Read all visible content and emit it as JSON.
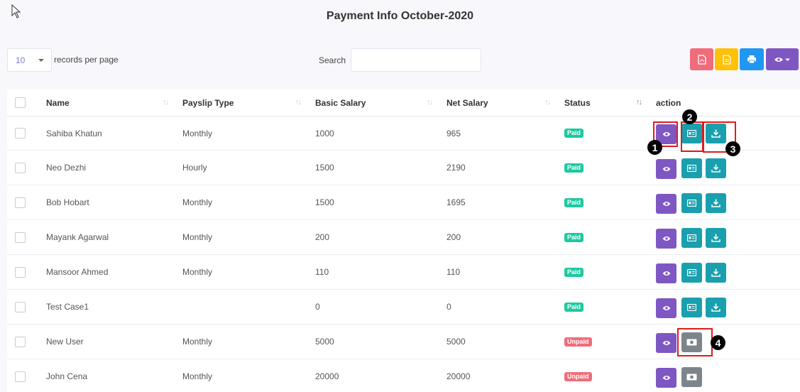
{
  "page": {
    "title": "Payment Info October-2020"
  },
  "controls": {
    "records_per_page_value": "10",
    "records_per_page_label": "records per page",
    "search_label": "Search",
    "search_value": ""
  },
  "columns": [
    "Name",
    "Payslip Type",
    "Basic Salary",
    "Net Salary",
    "Status",
    "action"
  ],
  "rows": [
    {
      "name": "Sahiba Khatun",
      "payslip_type": "Monthly",
      "basic_salary": "1000",
      "net_salary": "965",
      "status": "Paid"
    },
    {
      "name": "Neo Dezhi",
      "payslip_type": "Hourly",
      "basic_salary": "1500",
      "net_salary": "2190",
      "status": "Paid"
    },
    {
      "name": "Bob Hobart",
      "payslip_type": "Monthly",
      "basic_salary": "1500",
      "net_salary": "1695",
      "status": "Paid"
    },
    {
      "name": "Mayank Agarwal",
      "payslip_type": "Monthly",
      "basic_salary": "200",
      "net_salary": "200",
      "status": "Paid"
    },
    {
      "name": "Mansoor Ahmed",
      "payslip_type": "Monthly",
      "basic_salary": "110",
      "net_salary": "110",
      "status": "Paid"
    },
    {
      "name": "Test Case1",
      "payslip_type": "",
      "basic_salary": "0",
      "net_salary": "0",
      "status": "Paid"
    },
    {
      "name": "New User",
      "payslip_type": "Monthly",
      "basic_salary": "5000",
      "net_salary": "5000",
      "status": "Unpaid"
    },
    {
      "name": "John Cena",
      "payslip_type": "Monthly",
      "basic_salary": "20000",
      "net_salary": "20000",
      "status": "Unpaid"
    }
  ],
  "callouts": [
    "1",
    "2",
    "3",
    "4"
  ],
  "icons": {
    "tools": [
      "pdf-icon",
      "file-icon",
      "print-icon",
      "eye-dropdown-icon"
    ],
    "actions": [
      "eye-icon",
      "payslip-icon",
      "download-icon",
      "money-icon"
    ]
  },
  "colors": {
    "view": "#7e57c2",
    "payslip": "#1a9fae",
    "pay": "#7d858c",
    "paid": "#1dc9a0",
    "unpaid": "#f06c7a",
    "highlight": "#e01b1b"
  }
}
